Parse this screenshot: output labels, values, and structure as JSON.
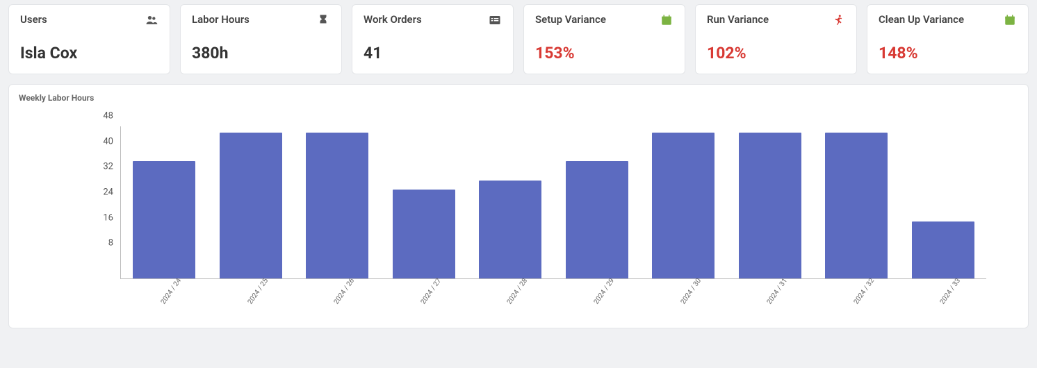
{
  "cards": [
    {
      "title": "Users",
      "value": "Isla Cox",
      "icon": "users-icon",
      "iconColor": "#555",
      "red": false
    },
    {
      "title": "Labor Hours",
      "value": "380h",
      "icon": "hourglass-icon",
      "iconColor": "#555",
      "red": false
    },
    {
      "title": "Work Orders",
      "value": "41",
      "icon": "list-icon",
      "iconColor": "#555",
      "red": false
    },
    {
      "title": "Setup Variance",
      "value": "153%",
      "icon": "calendar-icon",
      "iconColor": "#7cb342",
      "red": true
    },
    {
      "title": "Run Variance",
      "value": "102%",
      "icon": "running-icon",
      "iconColor": "#d83a34",
      "red": true
    },
    {
      "title": "Clean Up Variance",
      "value": "148%",
      "icon": "calendar-icon",
      "iconColor": "#7cb342",
      "red": true
    }
  ],
  "chart_title": "Weekly Labor Hours",
  "chart_data": {
    "type": "bar",
    "title": "Weekly Labor Hours",
    "xlabel": "",
    "ylabel": "",
    "ylim": [
      0,
      48
    ],
    "yticks": [
      8,
      16,
      24,
      32,
      40,
      48
    ],
    "categories": [
      "2024 / 24",
      "2024 / 25",
      "2024 / 26",
      "2024 / 27",
      "2024 / 28",
      "2024 / 29",
      "2024 / 30",
      "2024 / 31",
      "2024 / 32",
      "2024 / 33"
    ],
    "values": [
      37,
      46,
      46,
      28,
      31,
      37,
      46,
      46,
      46,
      18
    ],
    "bar_color": "#5c6bc0"
  }
}
